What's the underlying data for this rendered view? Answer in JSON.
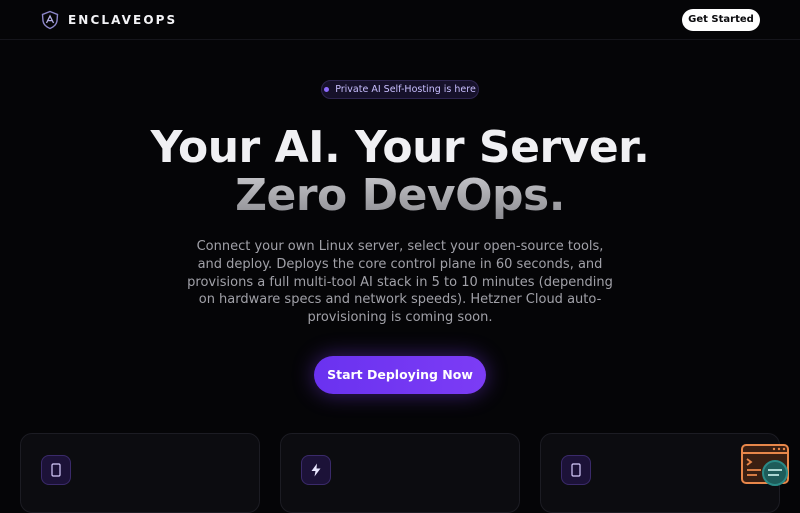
{
  "header": {
    "brand_name": "ENCLAVEOPS",
    "get_started_label": "Get Started"
  },
  "hero": {
    "badge_text": "Private AI Self-Hosting is here",
    "title_line1": "Your AI. Your Server.",
    "title_line2": "Zero DevOps.",
    "description": "Connect your own Linux server, select your open-source tools, and deploy. Deploys the core control plane in 60 seconds, and provisions a full multi-tool AI stack in 5 to 10 minutes (depending on hardware specs and network speeds). Hetzner Cloud auto-provisioning is coming soon.",
    "cta_label": "Start Deploying Now"
  },
  "features": [
    {
      "icon": "mobile-icon",
      "icon_glyph": "▯"
    },
    {
      "icon": "lightning-icon",
      "icon_glyph": "⚡"
    },
    {
      "icon": "mobile-icon",
      "icon_glyph": "▯"
    }
  ],
  "colors": {
    "background": "#050507",
    "accent": "#7c3cf5",
    "badge_dot": "#8e6bff",
    "widget_orange": "#e8874a",
    "widget_teal": "#2a8a86"
  }
}
